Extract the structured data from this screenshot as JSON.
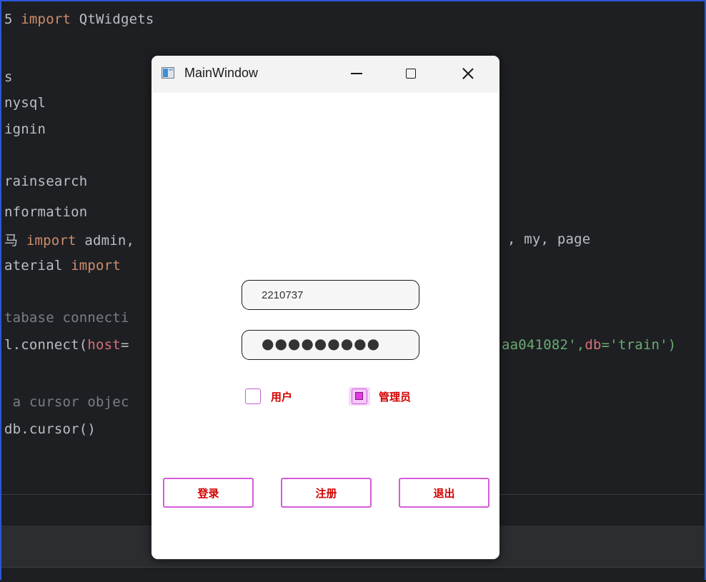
{
  "editor": {
    "lines": [
      "5 import QtWidgets",
      "s",
      "nysql",
      "ignin",
      "rainsearch",
      "nformation",
      "马 import admin,",
      "aterial import",
      "tabase connecti",
      "l.connect(host=",
      " a cursor objec",
      "db.cursor()"
    ],
    "line_right_1": ", my, page",
    "line_right_2": "aa041082',db='train')"
  },
  "window": {
    "title": "MainWindow",
    "icon": "app-window-icon",
    "minimize_icon": "minimize-icon",
    "maximize_icon": "maximize-icon",
    "close_icon": "close-icon"
  },
  "form": {
    "username_value": "2210737",
    "password_mask": "●●●●●●●●●",
    "role_user_label": "用户",
    "role_user_checked": false,
    "role_admin_label": "管理员",
    "role_admin_checked": true
  },
  "buttons": {
    "login": "登录",
    "register": "注册",
    "exit": "退出"
  },
  "colors": {
    "accent": "#d65bd9",
    "label_red": "#d20000",
    "editor_bg": "#1e1f22"
  }
}
